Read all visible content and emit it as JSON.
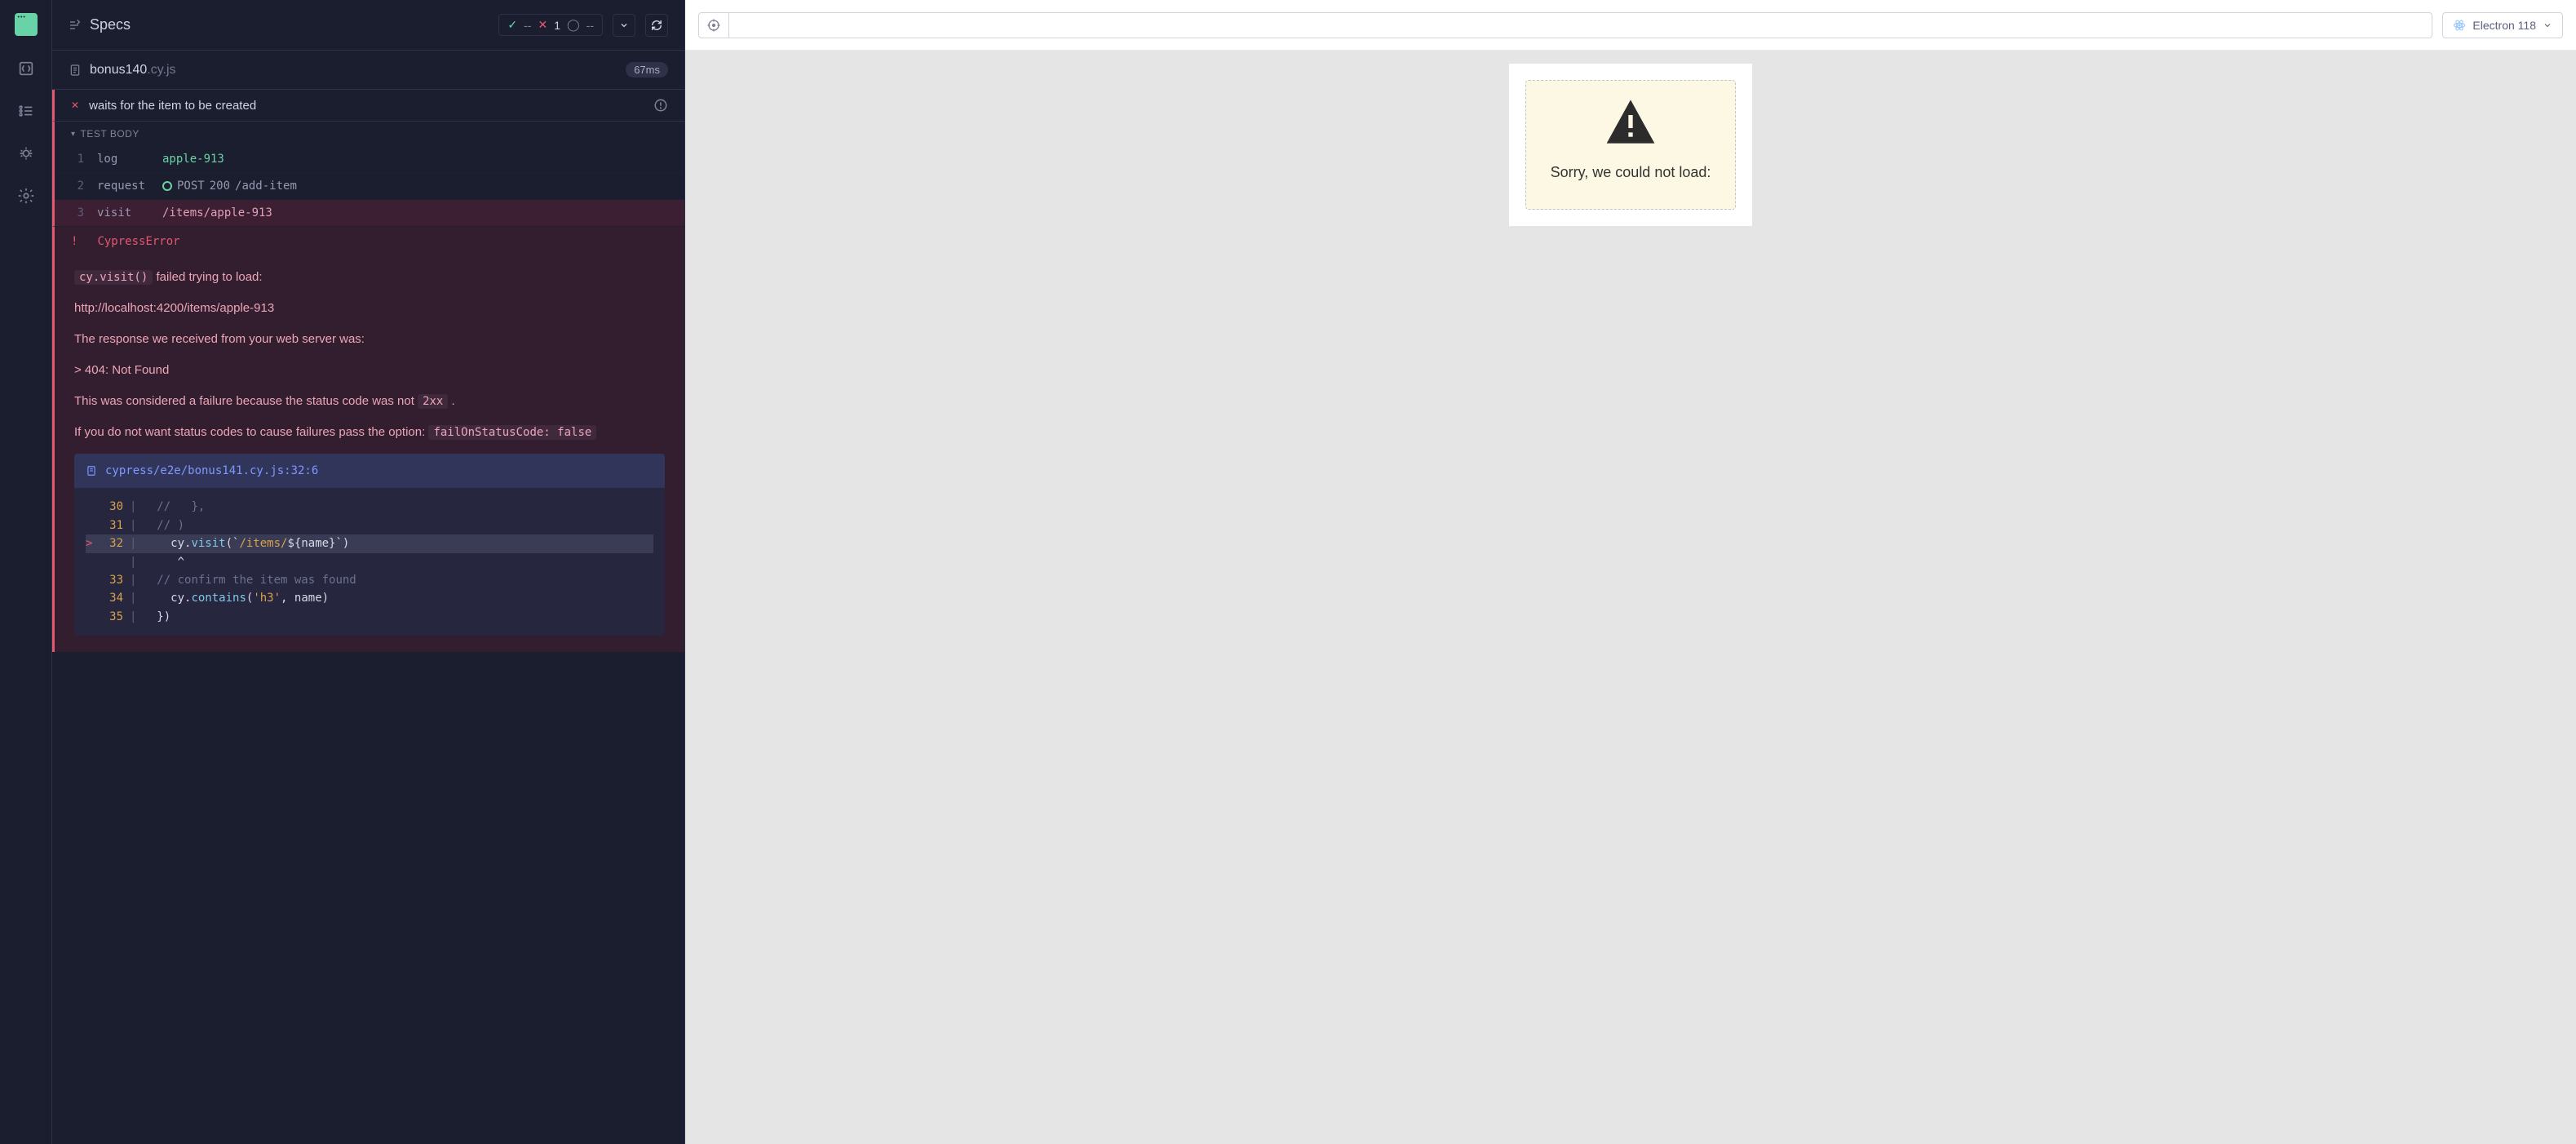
{
  "header": {
    "title": "Specs",
    "passed": "--",
    "failed": "1",
    "pending": "--"
  },
  "spec": {
    "name": "bonus140",
    "ext": ".cy.js",
    "duration": "67ms"
  },
  "test": {
    "title": "waits for the item to be created",
    "section": "TEST BODY"
  },
  "commands": [
    {
      "num": "1",
      "name": "log",
      "args": "apple-913"
    },
    {
      "num": "2",
      "name": "request",
      "method": "POST",
      "status": "200",
      "path": "/add-item"
    },
    {
      "num": "3",
      "name": "visit",
      "args": "/items/apple-913"
    }
  ],
  "error": {
    "type": "CypressError",
    "visit_cmd": "cy.visit()",
    "line1": "failed trying to load:",
    "url": "http://localhost:4200/items/apple-913",
    "line2": "The response we received from your web server was:",
    "status": "> 404: Not Found",
    "line3a": "This was considered a failure because the status code was not",
    "code2xx": "2xx",
    "line3b": ".",
    "line4": "If you do not want status codes to cause failures pass the option:",
    "opt": "failOnStatusCode: false"
  },
  "stack": {
    "location": "cypress/e2e/bonus141.cy.js:32:6",
    "lines": [
      {
        "caret": "",
        "n": "30",
        "code": "  //   },",
        "cls": "code-comment"
      },
      {
        "caret": "",
        "n": "31",
        "code": "  // )",
        "cls": "code-comment"
      },
      {
        "caret": ">",
        "n": "32",
        "code_parts": [
          {
            "t": "    cy.",
            "c": "code-var"
          },
          {
            "t": "visit",
            "c": "code-fn"
          },
          {
            "t": "(`",
            "c": "code-var"
          },
          {
            "t": "/items/",
            "c": "code-str"
          },
          {
            "t": "${name}",
            "c": "code-var"
          },
          {
            "t": "`)",
            "c": "code-var"
          }
        ],
        "highlight": true
      },
      {
        "caret": "",
        "n": "",
        "code": "     ^",
        "cls": "code-var"
      },
      {
        "caret": "",
        "n": "33",
        "code": "  // confirm the item was found",
        "cls": "code-comment"
      },
      {
        "caret": "",
        "n": "34",
        "code_parts": [
          {
            "t": "    cy.",
            "c": "code-var"
          },
          {
            "t": "contains",
            "c": "code-fn"
          },
          {
            "t": "(",
            "c": "code-var"
          },
          {
            "t": "'h3'",
            "c": "code-str"
          },
          {
            "t": ", name)",
            "c": "code-var"
          }
        ]
      },
      {
        "caret": "",
        "n": "35",
        "code": "  })",
        "cls": "code-var"
      }
    ]
  },
  "browser": {
    "name": "Electron 118"
  },
  "preview": {
    "message": "Sorry, we could not load:"
  }
}
